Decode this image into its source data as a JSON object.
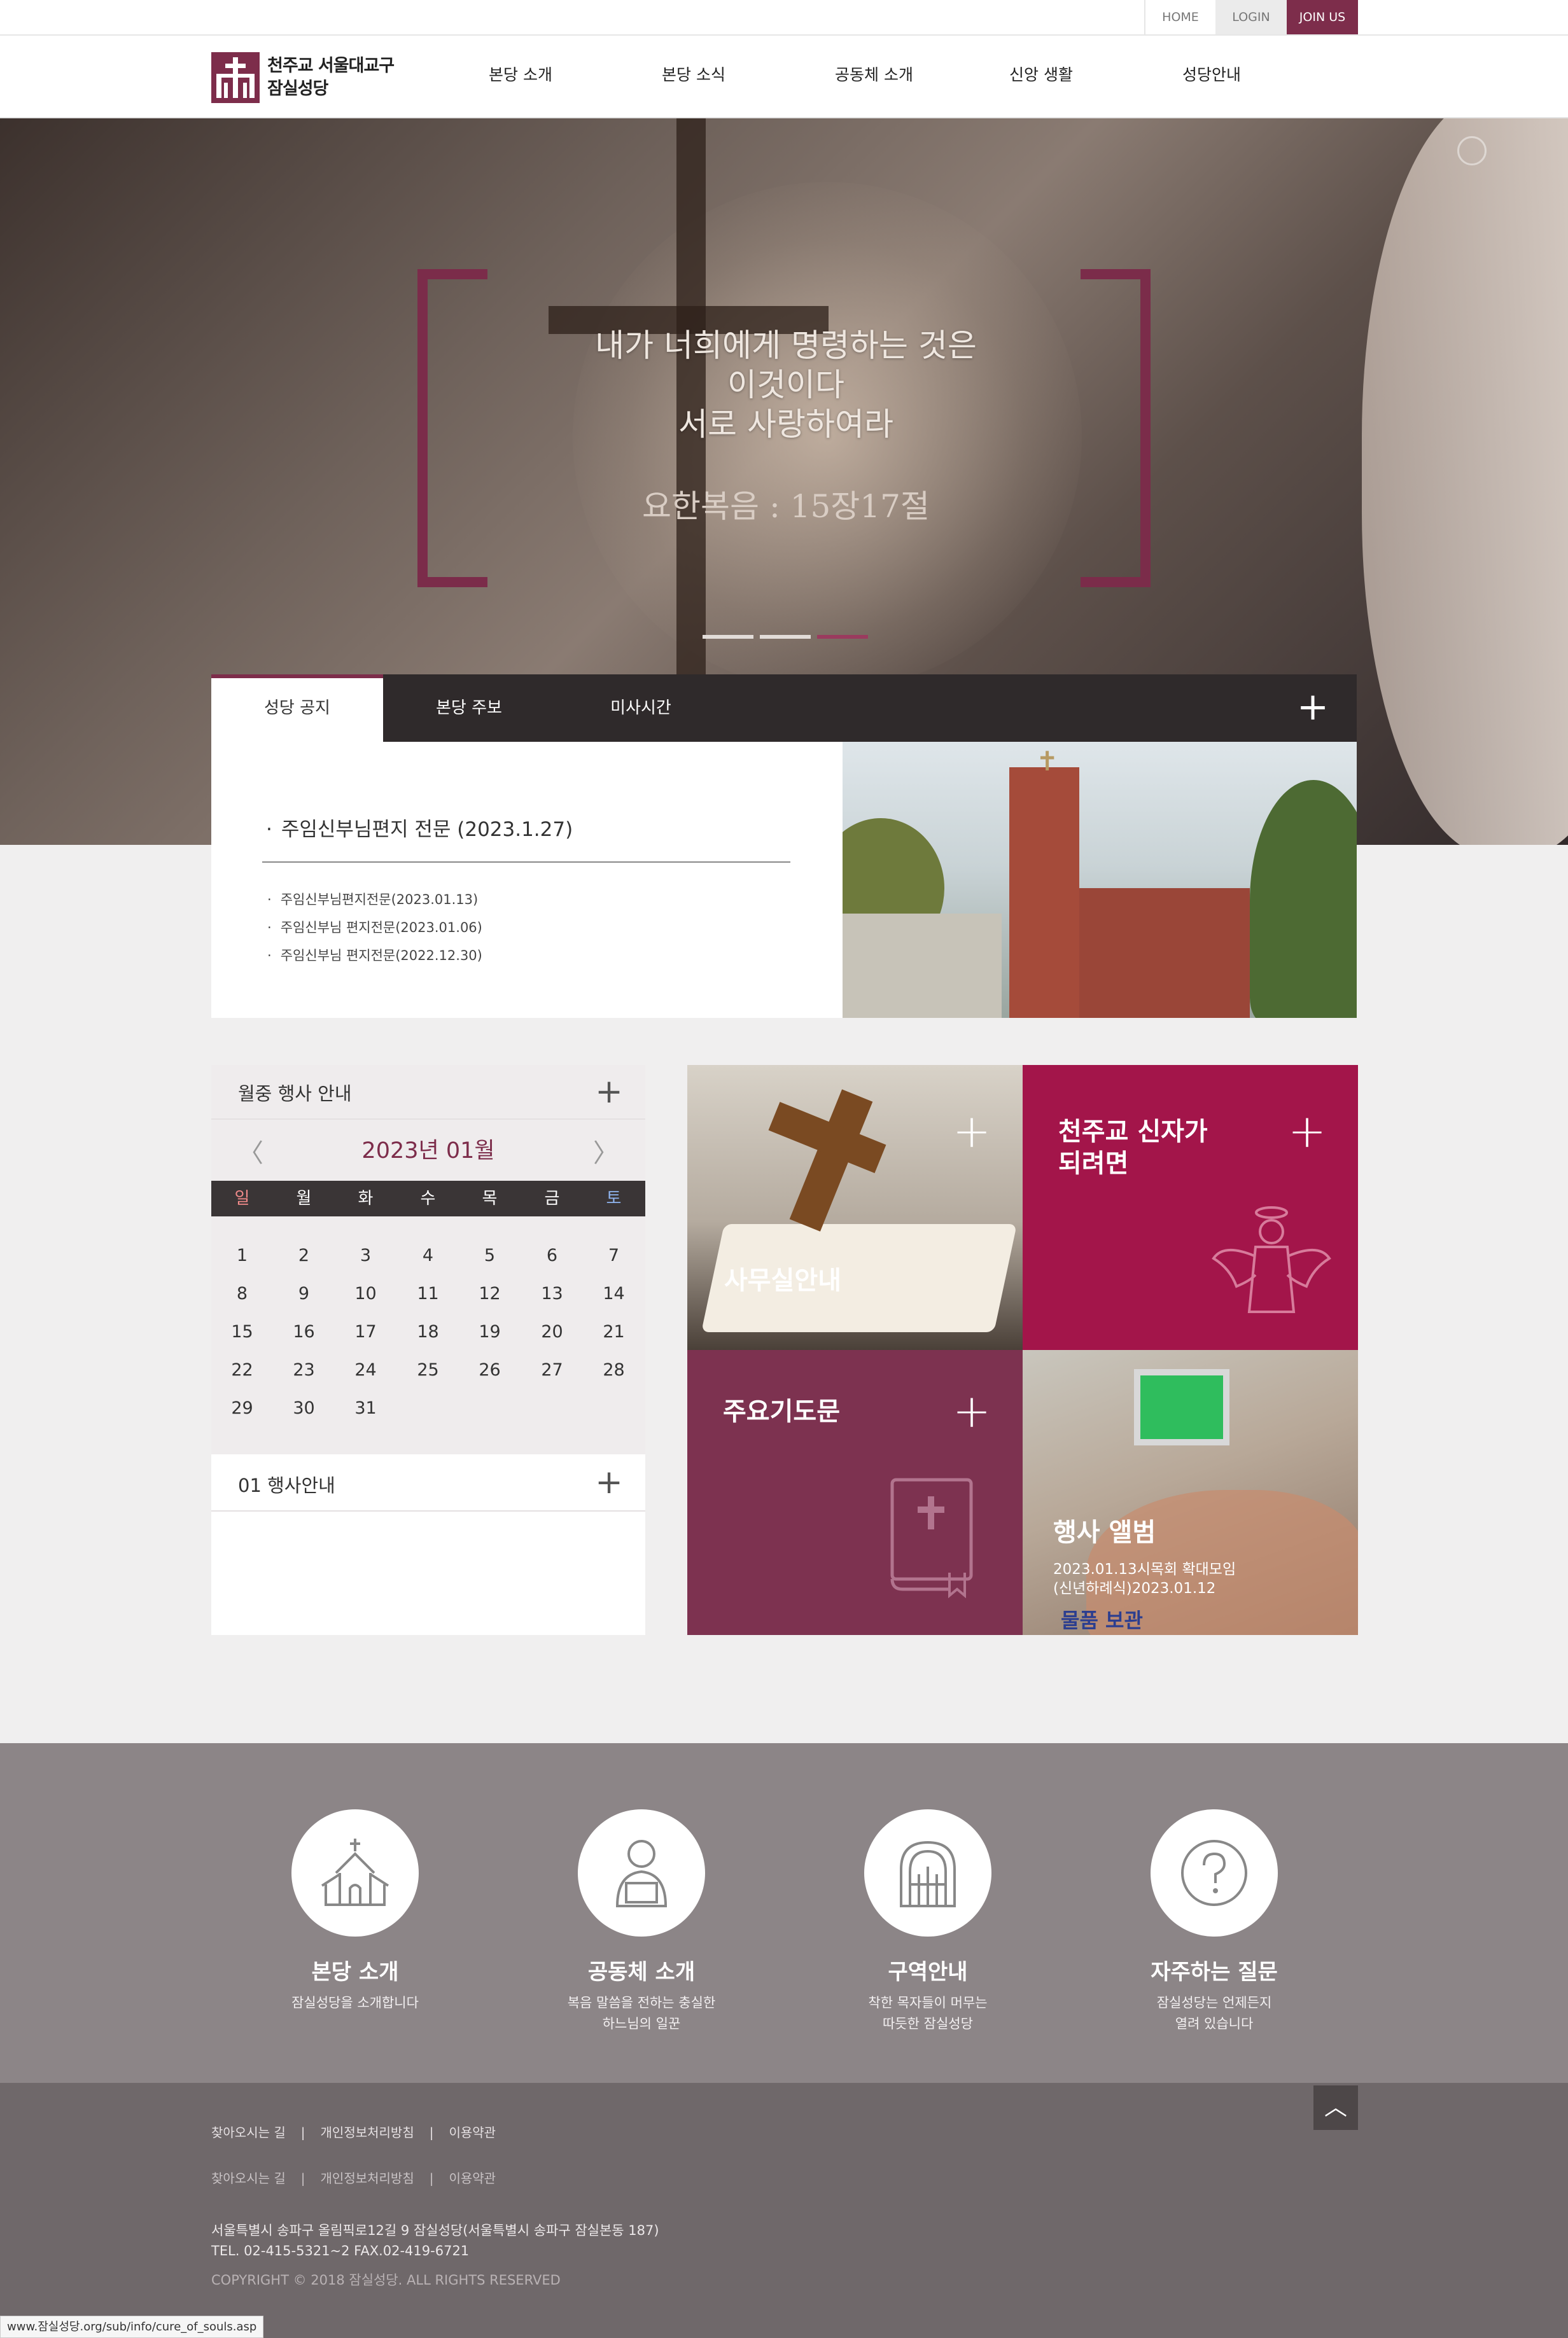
{
  "util_nav": {
    "home": "HOME",
    "login": "LOGIN",
    "join": "JOIN US"
  },
  "logo": {
    "line1": "천주교 서울대교구",
    "line2": "잠실성당"
  },
  "gnb": [
    "본당 소개",
    "본당 소식",
    "공동체 소개",
    "신앙 생활",
    "성당안내"
  ],
  "hero": {
    "quote_line1": "내가 너희에게 명령하는 것은",
    "quote_line2": "이것이다",
    "quote_line3": "서로 사랑하여라",
    "cite": "요한복음 : 15장17절",
    "slides": 3,
    "active_slide": 3
  },
  "notice": {
    "tabs": [
      "성당 공지",
      "본당 주보",
      "미사시간"
    ],
    "active_tab": "성당 공지",
    "main": "주임신부님편지 전문 (2023.1.27)",
    "items": [
      "주임신부님편지전문(2023.01.13)",
      "주임신부님 편지전문(2023.01.06)",
      "주임신부님 편지전문(2022.12.30)"
    ]
  },
  "calendar": {
    "title": "월중 행사 안내",
    "month": "2023년 01월",
    "prev": "〈",
    "next": "〉",
    "weekdays": [
      "일",
      "월",
      "화",
      "수",
      "목",
      "금",
      "토"
    ],
    "weeks": [
      [
        "1",
        "2",
        "3",
        "4",
        "5",
        "6",
        "7"
      ],
      [
        "8",
        "9",
        "10",
        "11",
        "12",
        "13",
        "14"
      ],
      [
        "15",
        "16",
        "17",
        "18",
        "19",
        "20",
        "21"
      ],
      [
        "22",
        "23",
        "24",
        "25",
        "26",
        "27",
        "28"
      ],
      [
        "29",
        "30",
        "31",
        "",
        "",
        "",
        ""
      ]
    ],
    "event_title": "01 행사안내"
  },
  "tiles": {
    "office": {
      "title": "사무실안내"
    },
    "become": {
      "title_line1": "천주교 신자가",
      "title_line2": "되려면"
    },
    "prayer": {
      "title": "주요기도문"
    },
    "album": {
      "title": "행사 앨범",
      "sub_line1": "2023.01.13시목회 확대모임",
      "sub_line2": "(신년하례식)2023.01.12",
      "sign": "물품 보관"
    }
  },
  "quick_links": [
    {
      "title": "본당 소개",
      "sub1": "잠실성당을 소개합니다",
      "sub2": "",
      "icon": "church-icon"
    },
    {
      "title": "공동체 소개",
      "sub1": "복음 말씀을 전하는 충실한",
      "sub2": "하느님의 일꾼",
      "icon": "person-icon"
    },
    {
      "title": "구역안내",
      "sub1": "착한 목자들이 머무는",
      "sub2": "따듯한 잠실성당",
      "icon": "gate-icon"
    },
    {
      "title": "자주하는 질문",
      "sub1": "잠실성당는 언제든지",
      "sub2": "열려 있습니다",
      "icon": "question-icon"
    }
  ],
  "footer": {
    "links": [
      "찾아오시는 길",
      "개인정보처리방침",
      "이용약관"
    ],
    "address": "서울특별시 송파구 올림픽로12길 9 잠실성당(서울특별시 송파구 잠실본동 187)",
    "tel": "TEL. 02-415-5321~2    FAX.02-419-6721",
    "copyright": "COPYRIGHT © 2018 잠실성당. ALL RIGHTS RESERVED"
  },
  "status_url": "www.잠실성당.org/sub/info/cure_of_souls.asp",
  "colors": {
    "brand": "#7d2d4b",
    "tile_red": "#a3154a",
    "tile_plum": "#7d3250",
    "quick_band": "#8c8587",
    "footer": "#6f686a"
  }
}
